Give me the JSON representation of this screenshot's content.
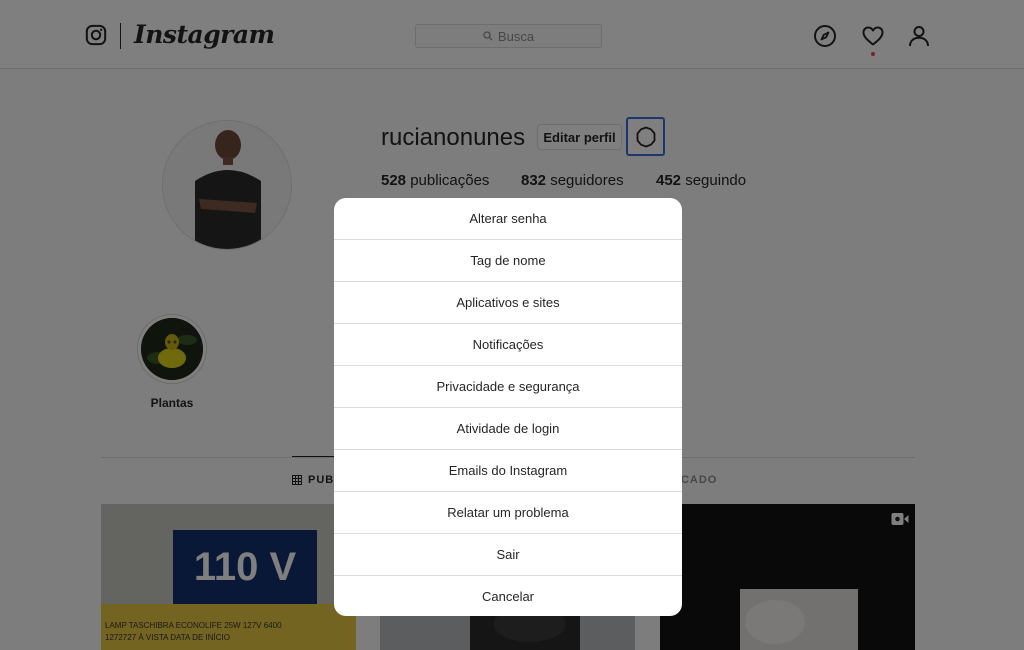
{
  "header": {
    "wordmark": "Instagram",
    "search_placeholder": "Busca",
    "icons": [
      "instagram-glyph-icon",
      "search-icon",
      "compass-icon",
      "heart-icon",
      "user-icon"
    ]
  },
  "profile": {
    "username": "rucianonunes",
    "edit_button": "Editar perfil",
    "stats": {
      "posts_count": "528",
      "posts_label": "publicações",
      "followers_count": "832",
      "followers_label": "seguidores",
      "following_count": "452",
      "following_label": "seguindo"
    }
  },
  "highlights": [
    {
      "label": "Plantas"
    }
  ],
  "tabs": [
    {
      "label": "PUB",
      "active": true
    },
    {
      "label": "RCADO",
      "active": false
    }
  ],
  "posts": [
    {
      "sign_text": "110 V",
      "label_line1": "LAMP TASCHIBRA ECONOLIFE 25W 127V 6400",
      "label_line2": "1272727   À VISTA        DATA DE INÍCIO"
    },
    {},
    {
      "has_video_icon": true
    }
  ],
  "menu": {
    "items": [
      "Alterar senha",
      "Tag de nome",
      "Aplicativos e sites",
      "Notificações",
      "Privacidade e segurança",
      "Atividade de login",
      "Emails do Instagram",
      "Relatar um problema",
      "Sair",
      "Cancelar"
    ]
  },
  "colors": {
    "overlay": "rgba(0,0,0,0.5)",
    "focus_ring": "#3b6ed8",
    "notification_dot": "#ed4956",
    "text": "#262626",
    "muted": "#8e8e8e",
    "border": "#dbdbdb"
  }
}
